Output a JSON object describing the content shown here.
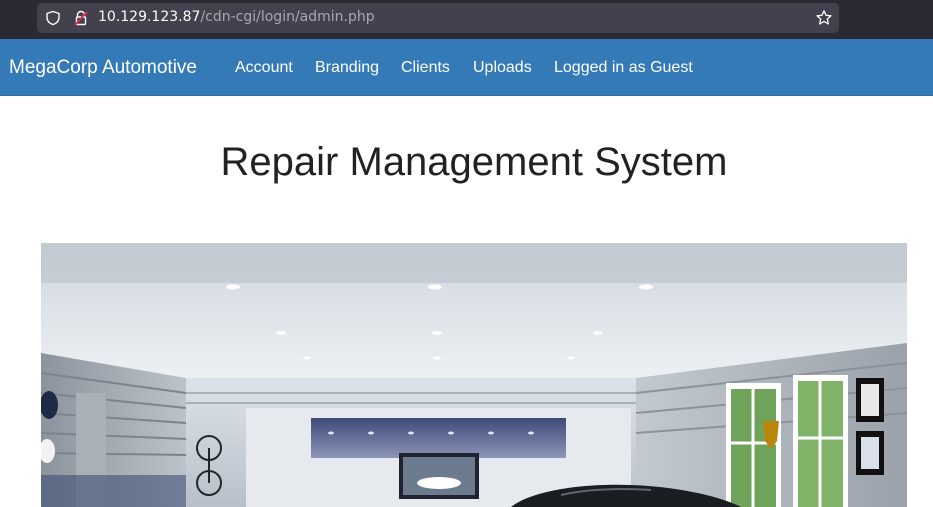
{
  "browser": {
    "url_host": "10.129.123.87",
    "url_path": "/cdn-cgi/login/admin.php",
    "icons": [
      "shield-icon",
      "lock-warning-icon",
      "star-icon"
    ]
  },
  "navbar": {
    "brand": "MegaCorp Automotive",
    "items": [
      {
        "label": "Account"
      },
      {
        "label": "Branding"
      },
      {
        "label": "Clients"
      },
      {
        "label": "Uploads"
      },
      {
        "label": "Logged in as Guest"
      }
    ],
    "color": "#337ab7"
  },
  "main": {
    "title": "Repair Management System"
  }
}
